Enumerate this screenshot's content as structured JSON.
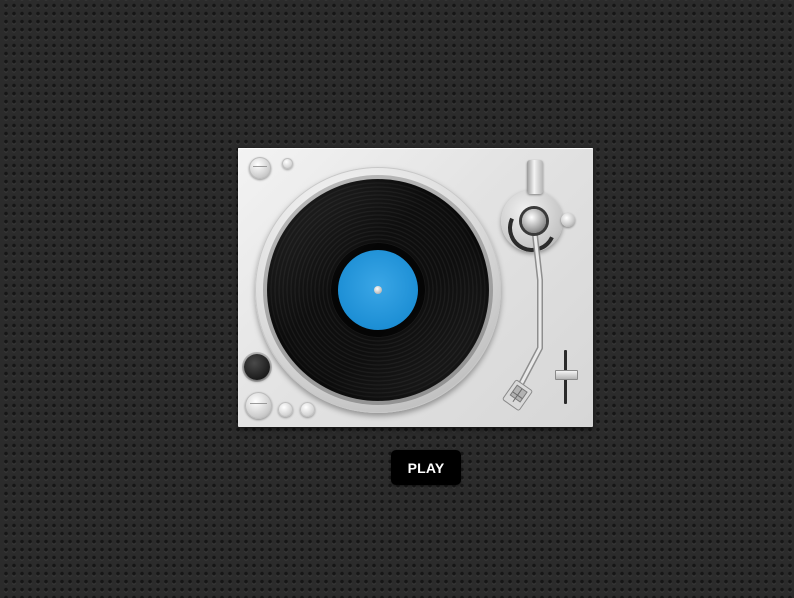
{
  "controls": {
    "play_label": "PLAY"
  },
  "record": {
    "label_color": "#1d8fd5"
  },
  "icons": [
    "turntable",
    "vinyl-record",
    "tonearm",
    "pitch-slider",
    "knob"
  ]
}
